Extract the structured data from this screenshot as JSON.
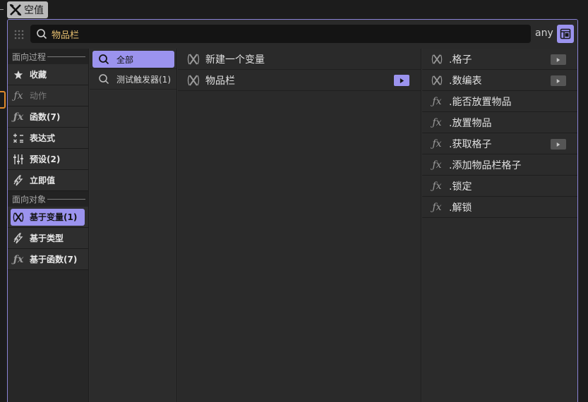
{
  "node_tag": {
    "label": "空值",
    "icon": "variable-x-icon"
  },
  "search": {
    "value": "物品栏",
    "placeholder": ""
  },
  "type_filter": "any",
  "categories": {
    "process_title": "面向过程",
    "process_items": [
      {
        "label": "收藏",
        "icon": "star-icon"
      },
      {
        "label": "动作",
        "icon": "fx-icon",
        "disabled": true
      },
      {
        "label": "函数(7)",
        "icon": "fx-icon"
      },
      {
        "label": "表达式",
        "icon": "expression-icon"
      },
      {
        "label": "预设(2)",
        "icon": "preset-icon"
      },
      {
        "label": "立即值",
        "icon": "lightning-icon"
      }
    ],
    "object_title": "面向对象",
    "object_items": [
      {
        "label": "基于变量(1)",
        "icon": "variable-x-icon",
        "active": true
      },
      {
        "label": "基于类型",
        "icon": "lightning-icon"
      },
      {
        "label": "基于函数(7)",
        "icon": "fx-icon"
      }
    ]
  },
  "filters": [
    {
      "label": "全部",
      "selected": true
    },
    {
      "label": "测试触发器(1)"
    }
  ],
  "variables": [
    {
      "label": "新建一个变量"
    },
    {
      "label": "物品栏",
      "has_submenu": true
    }
  ],
  "members": [
    {
      "label": ".格子",
      "icon": "variable-x-icon",
      "has_submenu": true
    },
    {
      "label": ".数编表",
      "icon": "variable-x-icon",
      "has_submenu": true
    },
    {
      "label": ".能否放置物品",
      "icon": "fx-icon"
    },
    {
      "label": ".放置物品",
      "icon": "fx-icon"
    },
    {
      "label": ".获取格子",
      "icon": "fx-icon",
      "has_submenu": true
    },
    {
      "label": ".添加物品栏格子",
      "icon": "fx-icon"
    },
    {
      "label": ".锁定",
      "icon": "fx-icon"
    },
    {
      "label": ".解锁",
      "icon": "fx-icon"
    }
  ],
  "colors": {
    "accent": "#9b93ee",
    "search_text": "#e8c070",
    "highlight_orange": "#e08a2c"
  }
}
